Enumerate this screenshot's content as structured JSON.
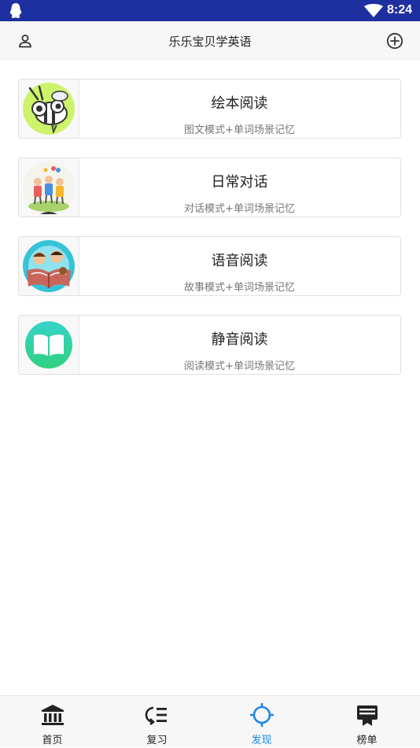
{
  "status_bar": {
    "time": "8:24"
  },
  "header": {
    "title": "乐乐宝贝学英语"
  },
  "cards": [
    {
      "title": "绘本阅读",
      "subtitle": "图文模式+单词场景记忆",
      "icon": "bee-cartoon-icon"
    },
    {
      "title": "日常对话",
      "subtitle": "对话模式+单词场景记忆",
      "icon": "children-playing-icon"
    },
    {
      "title": "语音阅读",
      "subtitle": "故事模式+单词场景记忆",
      "icon": "kids-reading-book-icon"
    },
    {
      "title": "静音阅读",
      "subtitle": "阅读模式+单词场景记忆",
      "icon": "open-book-icon"
    }
  ],
  "tabs": [
    {
      "label": "首页",
      "icon": "bank-icon",
      "active": false
    },
    {
      "label": "复习",
      "icon": "review-list-icon",
      "active": false
    },
    {
      "label": "发现",
      "icon": "target-icon",
      "active": true
    },
    {
      "label": "榜单",
      "icon": "ranking-board-icon",
      "active": false
    }
  ],
  "colors": {
    "status_bar": "#1e2fa0",
    "active_tab": "#1e88e5",
    "book_icon": "#2ed3a8"
  }
}
